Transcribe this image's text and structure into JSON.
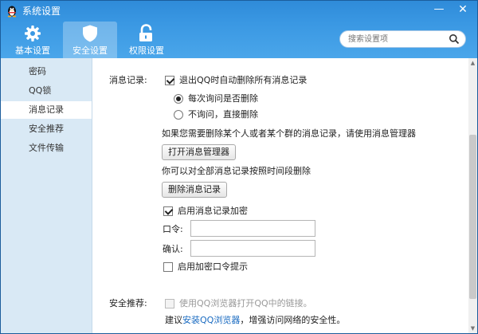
{
  "window": {
    "title": "系统设置",
    "minimize": "—",
    "close": "✕"
  },
  "tabs": [
    {
      "label": "基本设置",
      "icon": "gear-icon"
    },
    {
      "label": "安全设置",
      "icon": "shield-icon",
      "active": true
    },
    {
      "label": "权限设置",
      "icon": "unlock-icon"
    }
  ],
  "search": {
    "placeholder": "搜索设置项",
    "icon": "search-icon"
  },
  "sidebar": {
    "items": [
      {
        "label": "密码"
      },
      {
        "label": "QQ锁"
      },
      {
        "label": "消息记录",
        "active": true
      },
      {
        "label": "安全推荐"
      },
      {
        "label": "文件传输"
      }
    ]
  },
  "message_record": {
    "section_label": "消息记录:",
    "delete_on_exit": {
      "label": "退出QQ时自动删除所有消息记录",
      "checked": true
    },
    "options": [
      {
        "label": "每次询问是否删除",
        "checked": true
      },
      {
        "label": "不询问，直接删除",
        "checked": false
      }
    ],
    "manager_hint": "如果您需要删除某个人或者某个群的消息记录，请使用消息管理器",
    "open_manager_button": "打开消息管理器",
    "delete_hint": "你可以对全部消息记录按照时间段删除",
    "delete_button": "删除消息记录",
    "encrypt": {
      "label": "启用消息记录加密",
      "checked": true
    },
    "password_label": "口令:",
    "password_value": "",
    "confirm_label": "确认:",
    "confirm_value": "",
    "hint_option": {
      "label": "启用加密口令提示",
      "checked": false
    }
  },
  "security_recommend": {
    "section_label": "安全推荐:",
    "browser_option": {
      "label": "使用QQ浏览器打开QQ中的链接。",
      "checked": false,
      "disabled": true
    },
    "suggest_prefix": "建议",
    "suggest_link": "安装QQ浏览器",
    "suggest_suffix": "，增强访问网络的安全性。"
  },
  "colors": {
    "header": "#3a98e3",
    "sidebar": "#d9e9f5",
    "link": "#1a6bc1"
  }
}
